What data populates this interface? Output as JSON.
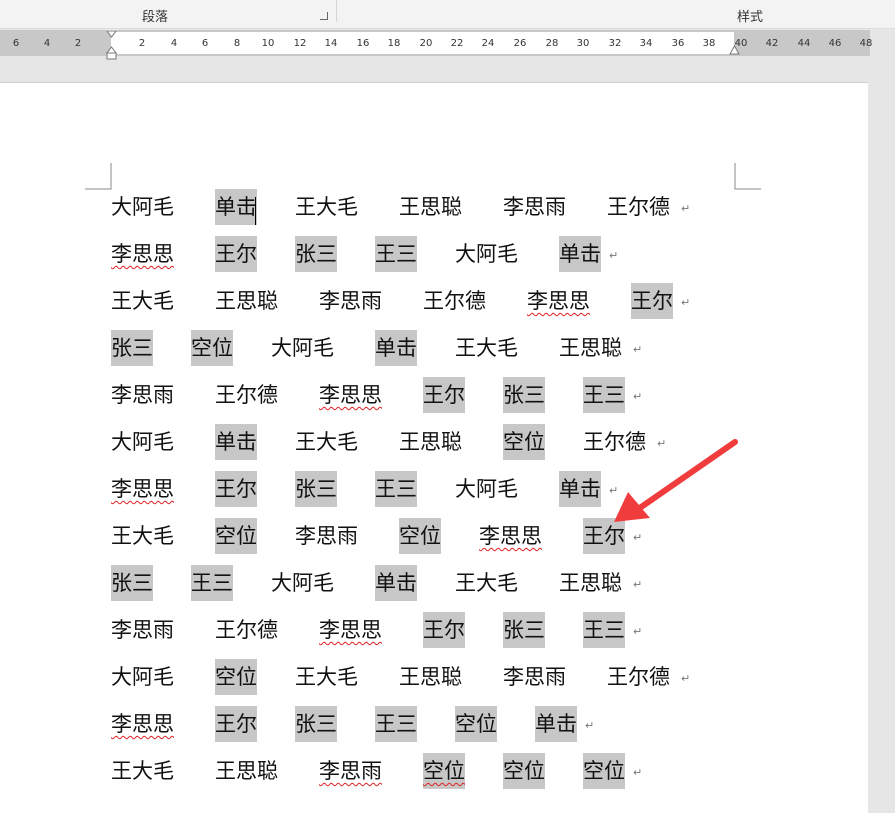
{
  "ribbon": {
    "paragraph_group": "段落",
    "styles_group": "样式"
  },
  "ruler": {
    "ticks": [
      "6",
      "4",
      "2",
      "2",
      "4",
      "6",
      "8",
      "10",
      "12",
      "14",
      "16",
      "18",
      "20",
      "22",
      "24",
      "26",
      "28",
      "30",
      "32",
      "34",
      "36",
      "38",
      "40",
      "42",
      "44",
      "46",
      "48"
    ]
  },
  "document": {
    "paragraph_mark": "↵",
    "lines": [
      [
        {
          "t": "大阿毛",
          "h": false,
          "s": false
        },
        {
          "t": "单击",
          "h": true,
          "s": false
        },
        {
          "t": "王大毛",
          "h": false,
          "s": false
        },
        {
          "t": "王思聪",
          "h": false,
          "s": false
        },
        {
          "t": "李思雨",
          "h": false,
          "s": false
        },
        {
          "t": "王尔德",
          "h": false,
          "s": false
        }
      ],
      [
        {
          "t": "李思思",
          "h": false,
          "s": true
        },
        {
          "t": "王尔",
          "h": true,
          "s": false
        },
        {
          "t": "张三",
          "h": true,
          "s": false
        },
        {
          "t": "王三",
          "h": true,
          "s": false
        },
        {
          "t": "大阿毛",
          "h": false,
          "s": false
        },
        {
          "t": "单击",
          "h": true,
          "s": false
        }
      ],
      [
        {
          "t": "王大毛",
          "h": false,
          "s": false
        },
        {
          "t": "王思聪",
          "h": false,
          "s": false
        },
        {
          "t": "李思雨",
          "h": false,
          "s": false
        },
        {
          "t": "王尔德",
          "h": false,
          "s": false
        },
        {
          "t": "李思思",
          "h": false,
          "s": true
        },
        {
          "t": "王尔",
          "h": true,
          "s": false
        }
      ],
      [
        {
          "t": "张三",
          "h": true,
          "s": false
        },
        {
          "t": "空位",
          "h": true,
          "s": false
        },
        {
          "t": "大阿毛",
          "h": false,
          "s": false
        },
        {
          "t": "单击",
          "h": true,
          "s": false
        },
        {
          "t": "王大毛",
          "h": false,
          "s": false
        },
        {
          "t": "王思聪",
          "h": false,
          "s": false
        }
      ],
      [
        {
          "t": "李思雨",
          "h": false,
          "s": false
        },
        {
          "t": "王尔德",
          "h": false,
          "s": false
        },
        {
          "t": "李思思",
          "h": false,
          "s": true
        },
        {
          "t": "王尔",
          "h": true,
          "s": false
        },
        {
          "t": "张三",
          "h": true,
          "s": false
        },
        {
          "t": "王三",
          "h": true,
          "s": false
        }
      ],
      [
        {
          "t": "大阿毛",
          "h": false,
          "s": false
        },
        {
          "t": "单击",
          "h": true,
          "s": false
        },
        {
          "t": "王大毛",
          "h": false,
          "s": false
        },
        {
          "t": "王思聪",
          "h": false,
          "s": false
        },
        {
          "t": "空位",
          "h": true,
          "s": false
        },
        {
          "t": "王尔德",
          "h": false,
          "s": false
        }
      ],
      [
        {
          "t": "李思思",
          "h": false,
          "s": true
        },
        {
          "t": "王尔",
          "h": true,
          "s": false
        },
        {
          "t": "张三",
          "h": true,
          "s": false
        },
        {
          "t": "王三",
          "h": true,
          "s": false
        },
        {
          "t": "大阿毛",
          "h": false,
          "s": false
        },
        {
          "t": "单击",
          "h": true,
          "s": false
        }
      ],
      [
        {
          "t": "王大毛",
          "h": false,
          "s": false
        },
        {
          "t": "空位",
          "h": true,
          "s": false
        },
        {
          "t": "李思雨",
          "h": false,
          "s": false
        },
        {
          "t": "空位",
          "h": true,
          "s": false
        },
        {
          "t": "李思思",
          "h": false,
          "s": true
        },
        {
          "t": "王尔",
          "h": true,
          "s": false
        }
      ],
      [
        {
          "t": "张三",
          "h": true,
          "s": false
        },
        {
          "t": "王三",
          "h": true,
          "s": false
        },
        {
          "t": "大阿毛",
          "h": false,
          "s": false
        },
        {
          "t": "单击",
          "h": true,
          "s": false
        },
        {
          "t": "王大毛",
          "h": false,
          "s": false
        },
        {
          "t": "王思聪",
          "h": false,
          "s": false
        }
      ],
      [
        {
          "t": "李思雨",
          "h": false,
          "s": false
        },
        {
          "t": "王尔德",
          "h": false,
          "s": false
        },
        {
          "t": "李思思",
          "h": false,
          "s": true
        },
        {
          "t": "王尔",
          "h": true,
          "s": false
        },
        {
          "t": "张三",
          "h": true,
          "s": false
        },
        {
          "t": "王三",
          "h": true,
          "s": false
        }
      ],
      [
        {
          "t": "大阿毛",
          "h": false,
          "s": false
        },
        {
          "t": "空位",
          "h": true,
          "s": false
        },
        {
          "t": "王大毛",
          "h": false,
          "s": false
        },
        {
          "t": "王思聪",
          "h": false,
          "s": false
        },
        {
          "t": "李思雨",
          "h": false,
          "s": false
        },
        {
          "t": "王尔德",
          "h": false,
          "s": false
        }
      ],
      [
        {
          "t": "李思思",
          "h": false,
          "s": true
        },
        {
          "t": "王尔",
          "h": true,
          "s": false
        },
        {
          "t": "张三",
          "h": true,
          "s": false
        },
        {
          "t": "王三",
          "h": true,
          "s": false
        },
        {
          "t": "空位",
          "h": true,
          "s": false
        },
        {
          "t": "单击",
          "h": true,
          "s": false
        }
      ],
      [
        {
          "t": "王大毛",
          "h": false,
          "s": false
        },
        {
          "t": "王思聪",
          "h": false,
          "s": false
        },
        {
          "t": "李思雨",
          "h": false,
          "s": true
        },
        {
          "t": "空位",
          "h": true,
          "s": true
        },
        {
          "t": "空位",
          "h": true,
          "s": false
        },
        {
          "t": "空位",
          "h": true,
          "s": false
        }
      ]
    ]
  },
  "colors": {
    "highlight": "#c7c7c7",
    "arrow": "#f03c3c",
    "squiggle": "#e02020"
  }
}
